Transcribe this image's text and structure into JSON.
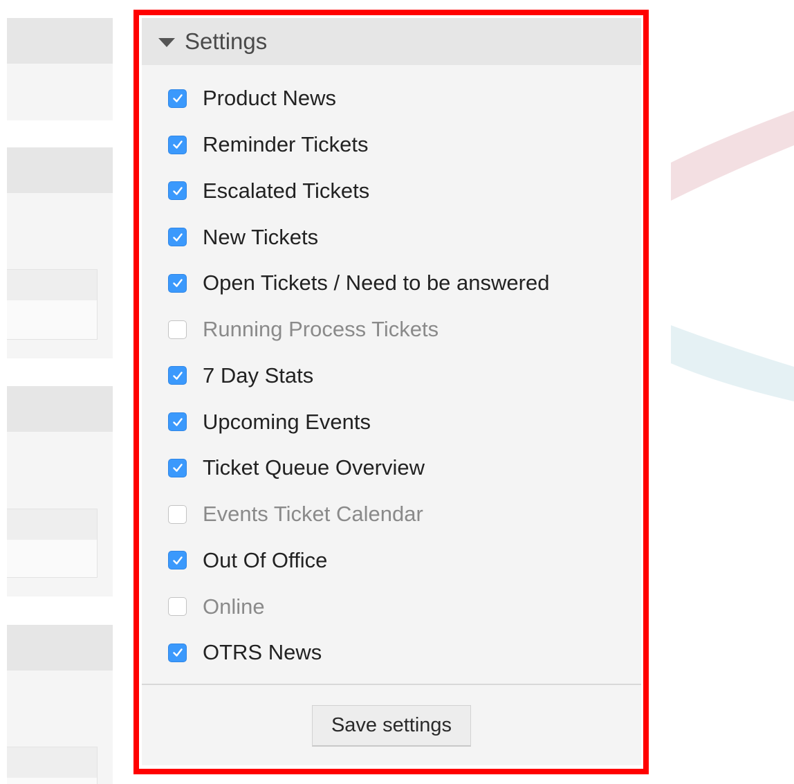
{
  "colors": {
    "highlight_border": "#ff0000",
    "checkbox_checked": "#3b99fc",
    "widget_background": "#f4f4f4",
    "header_background": "#e6e6e6"
  },
  "settings_widget": {
    "title": "Settings",
    "toggle_icon": "caret-down-icon",
    "options": [
      {
        "label": "Product News",
        "checked": true
      },
      {
        "label": "Reminder Tickets",
        "checked": true
      },
      {
        "label": "Escalated Tickets",
        "checked": true
      },
      {
        "label": "New Tickets",
        "checked": true
      },
      {
        "label": "Open Tickets / Need to be answered",
        "checked": true
      },
      {
        "label": "Running Process Tickets",
        "checked": false
      },
      {
        "label": "7 Day Stats",
        "checked": true
      },
      {
        "label": "Upcoming Events",
        "checked": true
      },
      {
        "label": "Ticket Queue Overview",
        "checked": true
      },
      {
        "label": "Events Ticket Calendar",
        "checked": false
      },
      {
        "label": "Out Of Office",
        "checked": true
      },
      {
        "label": "Online",
        "checked": false
      },
      {
        "label": "OTRS News",
        "checked": true
      }
    ],
    "save_label": "Save settings"
  }
}
